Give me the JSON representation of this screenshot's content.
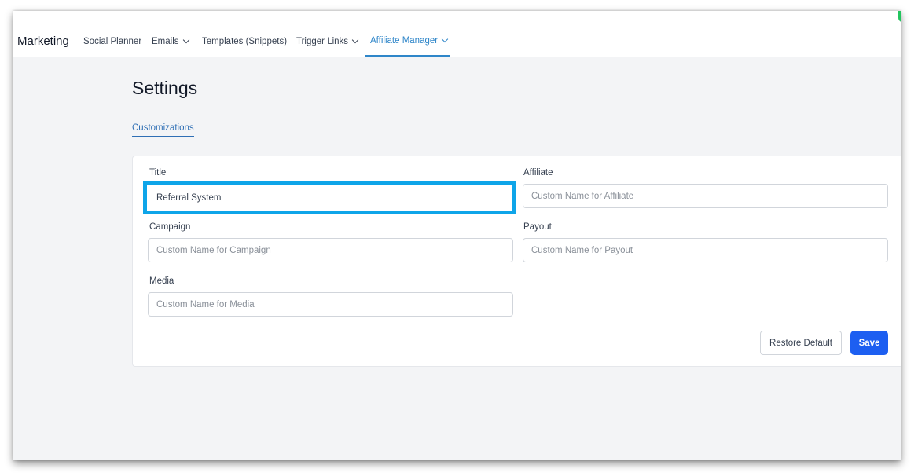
{
  "nav": {
    "brand": "Marketing",
    "items": [
      {
        "label": "Social Planner",
        "has_dropdown": false
      },
      {
        "label": "Emails",
        "has_dropdown": true
      },
      {
        "label": "Templates (Snippets)",
        "has_dropdown": false
      },
      {
        "label": "Trigger Links",
        "has_dropdown": true
      },
      {
        "label": "Affiliate Manager",
        "has_dropdown": true,
        "active": true
      }
    ],
    "active_color": "#2f86c9"
  },
  "page": {
    "title": "Settings",
    "tabs": [
      {
        "label": "Customizations",
        "active": true
      }
    ]
  },
  "form": {
    "title": {
      "label": "Title",
      "value": "Referral System",
      "placeholder": ""
    },
    "affiliate": {
      "label": "Affiliate",
      "value": "",
      "placeholder": "Custom Name for Affiliate"
    },
    "campaign": {
      "label": "Campaign",
      "value": "",
      "placeholder": "Custom Name for Campaign"
    },
    "payout": {
      "label": "Payout",
      "value": "",
      "placeholder": "Custom Name for Payout"
    },
    "media": {
      "label": "Media",
      "value": "",
      "placeholder": "Custom Name for Media"
    }
  },
  "actions": {
    "restore_label": "Restore Default",
    "save_label": "Save",
    "save_color": "#1d5ff1",
    "highlight_color": "#0ea5e9"
  }
}
